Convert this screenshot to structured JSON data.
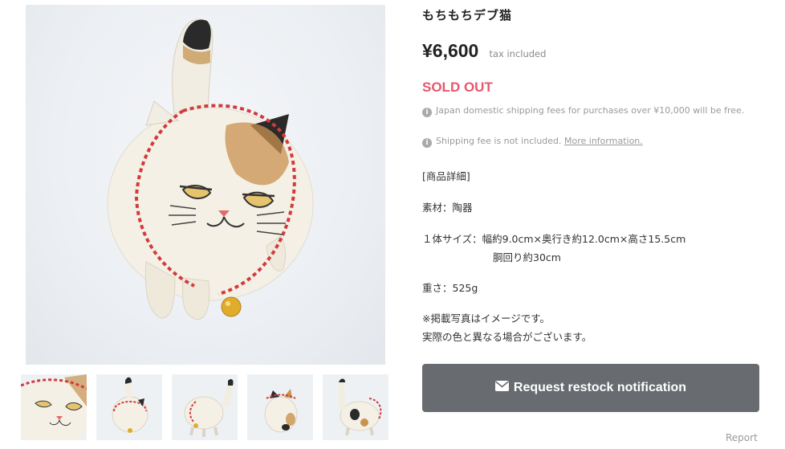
{
  "product": {
    "title": "もちもちデブ猫",
    "price": "¥6,600",
    "tax_note": "tax included",
    "status": "SOLD OUT"
  },
  "notices": {
    "shipping_free": "Japan domestic shipping fees for purchases over ¥10,000 will be free.",
    "shipping_not_included": "Shipping fee is not included.",
    "more_info_link": "More information."
  },
  "description": {
    "section_header": "[商品詳細]",
    "material": "素材：陶器",
    "size_line1": "１体サイズ：幅約9.0cm×奥行き約12.0cm×高さ15.5cm",
    "size_line2": "胴回り約30cm",
    "weight": "重さ：525g",
    "note_line1": "※掲載写真はイメージです。",
    "note_line2": "実際の色と異なる場合がございます。"
  },
  "actions": {
    "restock_label": "Request restock notification",
    "report_label": "Report"
  },
  "icons": {
    "info": "info-circle-icon",
    "mail": "envelope-icon"
  },
  "colors": {
    "sold_out": "#e8576b",
    "button_bg": "#686b70"
  }
}
